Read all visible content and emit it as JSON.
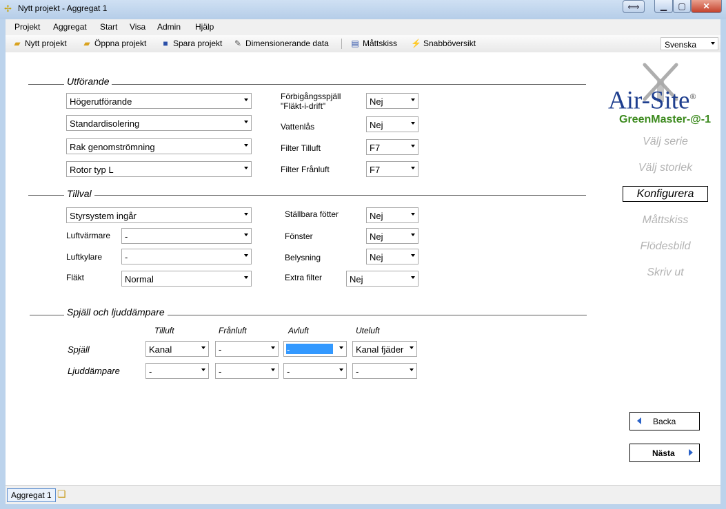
{
  "window": {
    "title": "Nytt projekt - Aggregat 1"
  },
  "menu": [
    "Projekt",
    "Aggregat",
    "Start",
    "Visa",
    "Admin",
    "Hjälp"
  ],
  "toolbar": {
    "new_project": "Nytt projekt",
    "open_project": "Öppna projekt",
    "save_project": "Spara projekt",
    "dim_data": "Dimensionerande data",
    "sketch": "Måttskiss",
    "quick_overview": "Snabböversikt",
    "language": "Svenska"
  },
  "section_utforande": {
    "title": "Utförande",
    "left": [
      "Högerutförande",
      "Standardisolering",
      "Rak genomströmning",
      "Rotor typ L"
    ],
    "right": [
      {
        "label": "Förbigångsspjäll\n\"Fläkt-i-drift\"",
        "value": "Nej"
      },
      {
        "label": "Vattenlås",
        "value": "Nej"
      },
      {
        "label": "Filter Tilluft",
        "value": "F7"
      },
      {
        "label": "Filter Frånluft",
        "value": "F7"
      }
    ]
  },
  "section_tillval": {
    "title": "Tillval",
    "styrsystem": "Styrsystem ingår",
    "luftvarmare_label": "Luftvärmare",
    "luftvarmare_value": "-",
    "luftkylare_label": "Luftkylare",
    "luftkylare_value": "-",
    "flakt_label": "Fläkt",
    "flakt_value": "Normal",
    "right": [
      {
        "label": "Ställbara fötter",
        "value": "Nej"
      },
      {
        "label": "Fönster",
        "value": "Nej"
      },
      {
        "label": "Belysning",
        "value": "Nej"
      },
      {
        "label": "Extra filter",
        "value": "Nej"
      }
    ]
  },
  "section_spjall": {
    "title": "Spjäll och ljuddämpare",
    "columns": [
      "Tilluft",
      "Frånluft",
      "Avluft",
      "Uteluft"
    ],
    "row1_label": "Spjäll",
    "row1": [
      "Kanal",
      "-",
      "-",
      "Kanal fjäder"
    ],
    "row2_label": "Ljuddämpare",
    "row2": [
      "-",
      "-",
      "-",
      "-"
    ]
  },
  "brand": {
    "logo_air": "Air",
    "logo_site": "Site",
    "registered": "®",
    "product": "GreenMaster-@-1",
    "product_color": "#3c8a1e",
    "logo_color": "#1f3f8f"
  },
  "nav": {
    "items": [
      "Välj serie",
      "Välj storlek",
      "Konfigurera",
      "Måttskiss",
      "Flödesbild",
      "Skriv ut"
    ],
    "active_index": 2
  },
  "buttons": {
    "back": "Backa",
    "next": "Nästa"
  },
  "statusbar": {
    "tab": "Aggregat 1"
  }
}
